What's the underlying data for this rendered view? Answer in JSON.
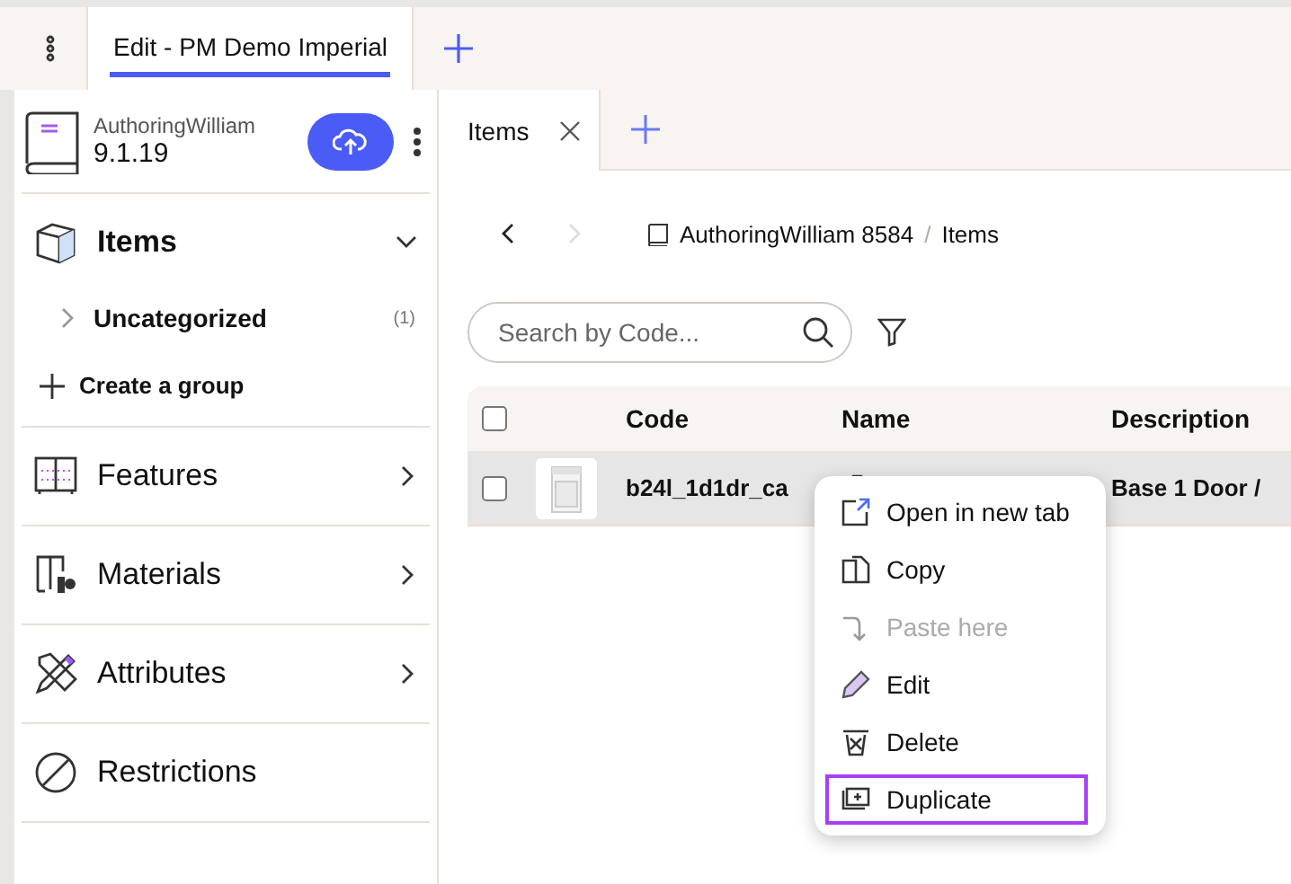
{
  "top_tabs": [
    {
      "label": "Edit - PM Demo Imperial",
      "selected": true
    }
  ],
  "catalog": {
    "name": "AuthoringWilliam",
    "version": "9.1.19"
  },
  "sidebar": {
    "items_section": {
      "label": "Items",
      "expanded": true,
      "groups": [
        {
          "label": "Uncategorized",
          "count": "(1)"
        }
      ],
      "create_label": "Create a group"
    },
    "sections": [
      {
        "kind": "features",
        "label": "Features",
        "has_arrow": true
      },
      {
        "kind": "materials",
        "label": "Materials",
        "has_arrow": true
      },
      {
        "kind": "attributes",
        "label": "Attributes",
        "has_arrow": true
      },
      {
        "kind": "restrictions",
        "label": "Restrictions",
        "has_arrow": false
      }
    ]
  },
  "content_tabs": [
    {
      "label": "Items",
      "selected": true
    }
  ],
  "breadcrumb": [
    "AuthoringWilliam 8584",
    "Items"
  ],
  "breadcrumb_separator": "/",
  "search": {
    "placeholder": "Search by Code..."
  },
  "table": {
    "select_all_checked": false,
    "columns": [
      "Code",
      "Name",
      "Description"
    ],
    "rows": [
      {
        "checked": false,
        "code": "b24l_1d1dr_ca",
        "description": "Base 1 Door /",
        "kind": "picture"
      }
    ]
  },
  "context_menu": [
    {
      "kind": "open",
      "label": "Open in new tab",
      "disabled": false,
      "selected": false
    },
    {
      "kind": "copy",
      "label": "Copy",
      "disabled": false,
      "selected": false
    },
    {
      "kind": "paste",
      "label": "Paste here",
      "disabled": true,
      "selected": false
    },
    {
      "kind": "edit",
      "label": "Edit",
      "disabled": false,
      "selected": false
    },
    {
      "kind": "delete",
      "label": "Delete",
      "disabled": false,
      "selected": false
    },
    {
      "kind": "duplicate",
      "label": "Duplicate",
      "disabled": false,
      "selected": true
    }
  ]
}
